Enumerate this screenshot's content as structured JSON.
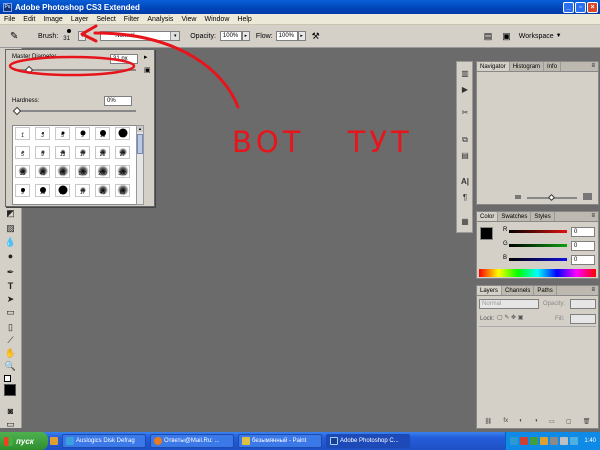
{
  "window": {
    "title": "Adobe Photoshop CS3 Extended",
    "app_icon": "Ps"
  },
  "menu": [
    "File",
    "Edit",
    "Image",
    "Layer",
    "Select",
    "Filter",
    "Analysis",
    "View",
    "Window",
    "Help"
  ],
  "options": {
    "brush_label": "Brush:",
    "brush_size": "31",
    "mode_value": "Normal",
    "opacity_label": "Opacity:",
    "opacity_value": "100%",
    "flow_label": "Flow:",
    "flow_value": "100%",
    "workspace_label": "Workspace"
  },
  "brush_popup": {
    "master_label": "Master Diameter",
    "master_value": "31 px",
    "hardness_label": "Hardness:",
    "hardness_value": "0%",
    "master_slider_fraction": 0.1,
    "hardness_slider_fraction": 0.0,
    "presets": [
      {
        "label": "1",
        "hard": true,
        "d": 1
      },
      {
        "label": "3",
        "hard": true,
        "d": 2
      },
      {
        "label": "5",
        "hard": true,
        "d": 3
      },
      {
        "label": "9",
        "hard": true,
        "d": 5
      },
      {
        "label": "13",
        "hard": true,
        "d": 6
      },
      {
        "label": "19",
        "hard": true,
        "d": 9
      },
      {
        "label": "5",
        "hard": false,
        "d": 3
      },
      {
        "label": "9",
        "hard": false,
        "d": 4
      },
      {
        "label": "13",
        "hard": false,
        "d": 5
      },
      {
        "label": "17",
        "hard": false,
        "d": 6
      },
      {
        "label": "21",
        "hard": false,
        "d": 7
      },
      {
        "label": "27",
        "hard": false,
        "d": 8
      },
      {
        "label": "35",
        "hard": false,
        "d": 9
      },
      {
        "label": "45",
        "hard": false,
        "d": 10
      },
      {
        "label": "65",
        "hard": false,
        "d": 11
      },
      {
        "label": "100",
        "hard": false,
        "d": 11
      },
      {
        "label": "200",
        "hard": false,
        "d": 11
      },
      {
        "label": "300",
        "hard": false,
        "d": 11
      },
      {
        "label": "9",
        "hard": true,
        "d": 4
      },
      {
        "label": "13",
        "hard": true,
        "d": 6
      },
      {
        "label": "19",
        "hard": true,
        "d": 9
      },
      {
        "label": "17",
        "hard": false,
        "d": 6
      },
      {
        "label": "45",
        "hard": false,
        "d": 10
      },
      {
        "label": "65",
        "hard": false,
        "d": 11
      }
    ]
  },
  "annotation": {
    "text": "ВОТ ТУТ",
    "color": "#e8141c"
  },
  "navigator": {
    "tabs": [
      "Navigator",
      "Histogram",
      "Info"
    ],
    "active": 0
  },
  "color_panel": {
    "tabs": [
      "Color",
      "Swatches",
      "Styles"
    ],
    "active": 0,
    "channels": [
      {
        "label": "R",
        "value": "0",
        "color": "#e01010"
      },
      {
        "label": "G",
        "value": "0",
        "color": "#10a010"
      },
      {
        "label": "B",
        "value": "0",
        "color": "#1010e0"
      }
    ]
  },
  "layers_panel": {
    "tabs": [
      "Layers",
      "Channels",
      "Paths"
    ],
    "active": 0,
    "blend_mode": "Normal",
    "opacity_label": "Opacity:",
    "lock_label": "Lock:",
    "fill_label": "Fill:"
  },
  "taskbar": {
    "start_label": "пуск",
    "tasks": [
      {
        "label": "Auslogics Disk Defrag",
        "icon_color": "#3aa0e0"
      },
      {
        "label": "Ответы@Mail.Ru: ...",
        "icon_color": "#e87a20"
      },
      {
        "label": "безымянный - Paint",
        "icon_color": "#e0c040"
      },
      {
        "label": "Adobe Photoshop C...",
        "icon_color": "#1b3f8f",
        "active": true
      }
    ],
    "clock": "1:40"
  }
}
